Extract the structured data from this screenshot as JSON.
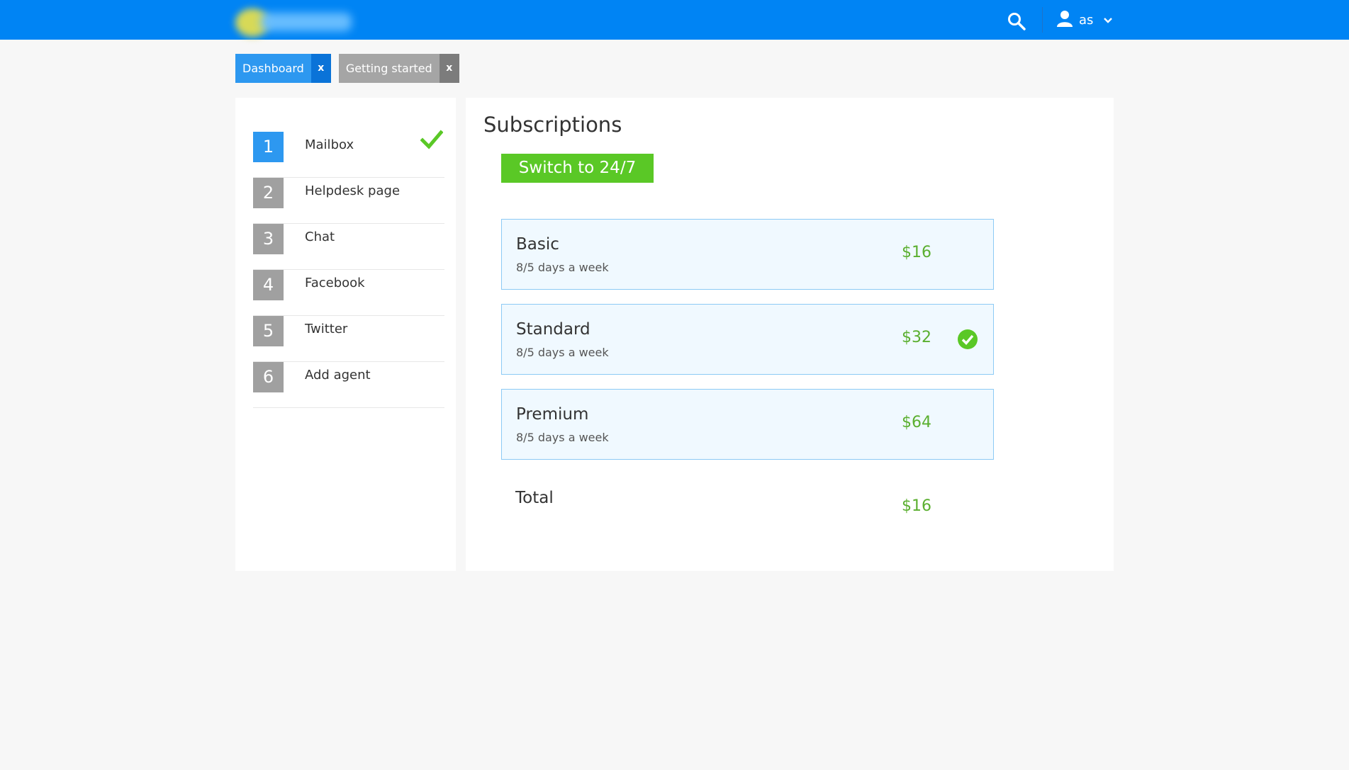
{
  "header": {
    "logo_icon": "blurred-logo",
    "search_icon": "search-icon",
    "user": {
      "icon": "user-icon",
      "name": "as",
      "dropdown_icon": "chevron-down-icon"
    },
    "colors": {
      "bar": "#0084f4"
    }
  },
  "tabs": [
    {
      "label": "Dashboard",
      "close": "x",
      "active": true
    },
    {
      "label": "Getting started",
      "close": "x",
      "active": false
    }
  ],
  "steps": [
    {
      "number": "1",
      "label": "Mailbox",
      "current": true,
      "completed": true
    },
    {
      "number": "2",
      "label": "Helpdesk page",
      "current": false,
      "completed": false
    },
    {
      "number": "3",
      "label": "Chat",
      "current": false,
      "completed": false
    },
    {
      "number": "4",
      "label": "Facebook",
      "current": false,
      "completed": false
    },
    {
      "number": "5",
      "label": "Twitter",
      "current": false,
      "completed": false
    },
    {
      "number": "6",
      "label": "Add agent",
      "current": false,
      "completed": false
    }
  ],
  "main": {
    "title": "Subscriptions",
    "switch_button": "Switch to 24/7",
    "plans": [
      {
        "name": "Basic",
        "description": "8/5 days a week",
        "price": "$16",
        "selected": false
      },
      {
        "name": "Standard",
        "description": "8/5 days a week",
        "price": "$32",
        "selected": true
      },
      {
        "name": "Premium",
        "description": "8/5 days a week",
        "price": "$64",
        "selected": false
      }
    ],
    "total_label": "Total",
    "total_value": "$16"
  },
  "colors": {
    "primary": "#2d98f0",
    "success": "#5ac826",
    "price": "#5aaf2f",
    "plan_bg": "#f0f9ff",
    "plan_border": "#8ccaf5"
  }
}
